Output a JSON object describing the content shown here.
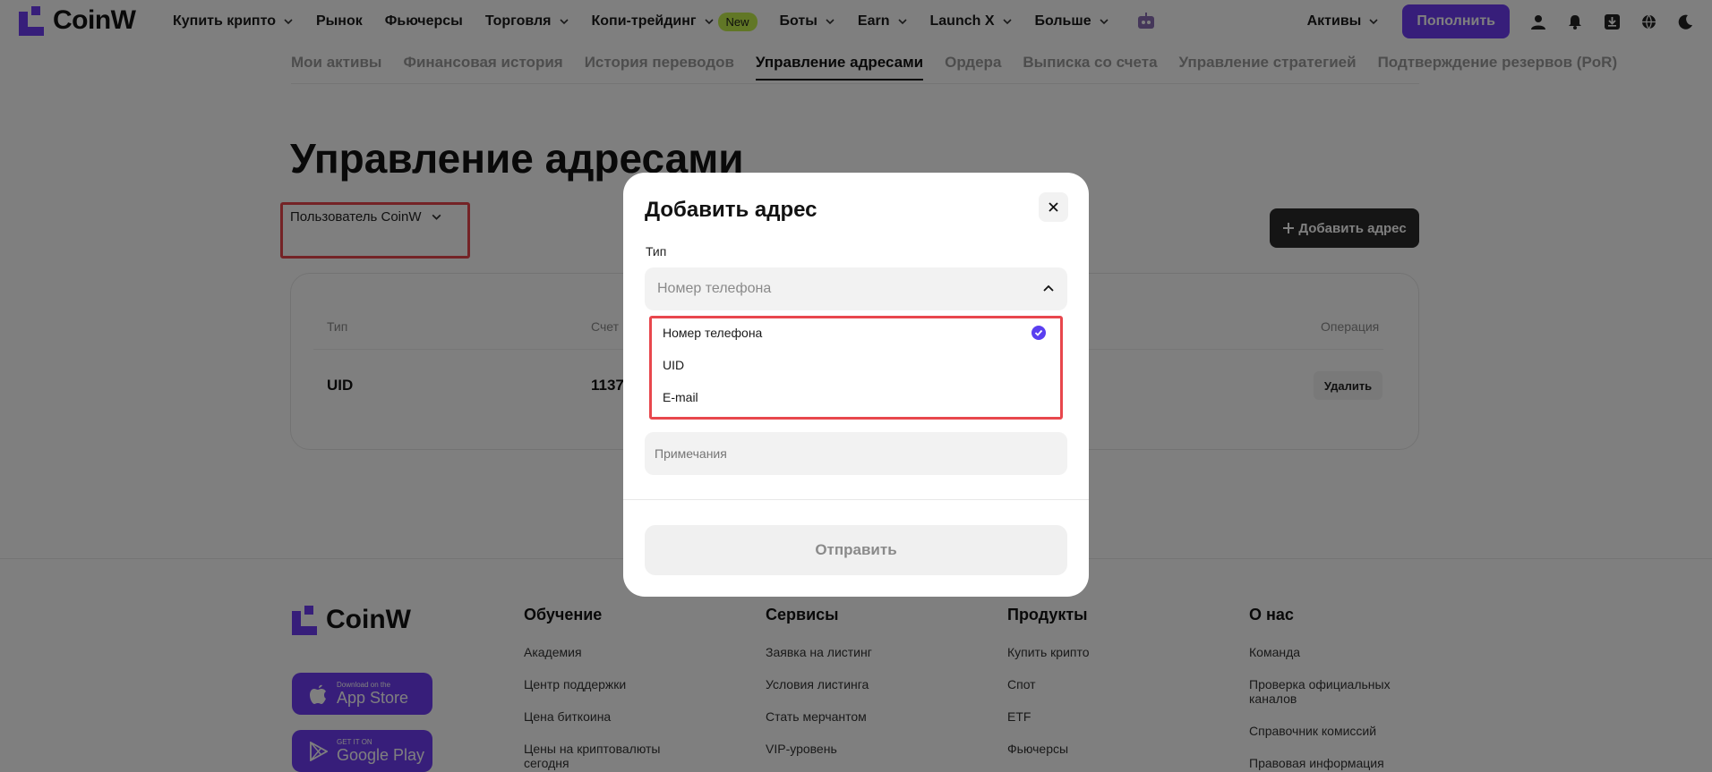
{
  "header": {
    "logo_text": "CoinW",
    "nav": [
      {
        "label": "Купить крипто",
        "dropdown": true
      },
      {
        "label": "Рынок",
        "dropdown": false
      },
      {
        "label": "Фьючерсы",
        "dropdown": false
      },
      {
        "label": "Торговля",
        "dropdown": true
      },
      {
        "label": "Копи-трейдинг",
        "dropdown": true,
        "badge": "New"
      },
      {
        "label": "Боты",
        "dropdown": true
      },
      {
        "label": "Earn",
        "dropdown": true
      },
      {
        "label": "Launch X",
        "dropdown": true
      },
      {
        "label": "Больше",
        "dropdown": true
      }
    ],
    "assets_label": "Активы",
    "deposit_label": "Пополнить",
    "icons": [
      "user-icon",
      "bell-icon",
      "download-icon",
      "globe-icon",
      "moon-icon"
    ]
  },
  "subtabs": [
    {
      "label": "Мои активы",
      "active": false
    },
    {
      "label": "Финансовая история",
      "active": false
    },
    {
      "label": "История переводов",
      "active": false
    },
    {
      "label": "Управление адресами",
      "active": true
    },
    {
      "label": "Ордера",
      "active": false
    },
    {
      "label": "Выписка со счета",
      "active": false
    },
    {
      "label": "Управление стратегией",
      "active": false
    },
    {
      "label": "Подтверждение резервов (PoR)",
      "active": false
    }
  ],
  "page": {
    "title": "Управление адресами",
    "user_filter": "Пользователь CoinW",
    "add_address_label": "Добавить адрес",
    "table": {
      "headers": [
        "Тип",
        "Счет",
        "Операция"
      ],
      "rows": [
        {
          "type": "UID",
          "account": "1137",
          "action": "Удалить"
        }
      ]
    }
  },
  "footer": {
    "logo_text": "CoinW",
    "app_store": {
      "small": "Download on the",
      "big": "App Store"
    },
    "google_play": {
      "small": "GET IT ON",
      "big": "Google Play"
    },
    "columns": [
      {
        "title": "Обучение",
        "links": [
          "Академия",
          "Центр поддержки",
          "Цена биткоина",
          "Цены на криптовалюты сегодня"
        ]
      },
      {
        "title": "Сервисы",
        "links": [
          "Заявка на листинг",
          "Условия листинга",
          "Стать мерчантом",
          "VIP-уровень"
        ]
      },
      {
        "title": "Продукты",
        "links": [
          "Купить крипто",
          "Спот",
          "ETF",
          "Фьючерсы"
        ]
      },
      {
        "title": "О нас",
        "links": [
          "Команда",
          "Проверка официальных каналов",
          "Справочник комиссий",
          "Правовая информация"
        ]
      }
    ]
  },
  "modal": {
    "title": "Добавить адрес",
    "type_label": "Тип",
    "selected_type": "Номер телефона",
    "options": [
      {
        "label": "Номер телефона",
        "selected": true
      },
      {
        "label": "UID",
        "selected": false
      },
      {
        "label": "E-mail",
        "selected": false
      }
    ],
    "remarks_placeholder": "Примечания",
    "submit_label": "Отправить"
  },
  "colors": {
    "brand": "#6f3cf4",
    "highlight_box": "#e8474d",
    "new_badge": "#c3ef4c"
  }
}
